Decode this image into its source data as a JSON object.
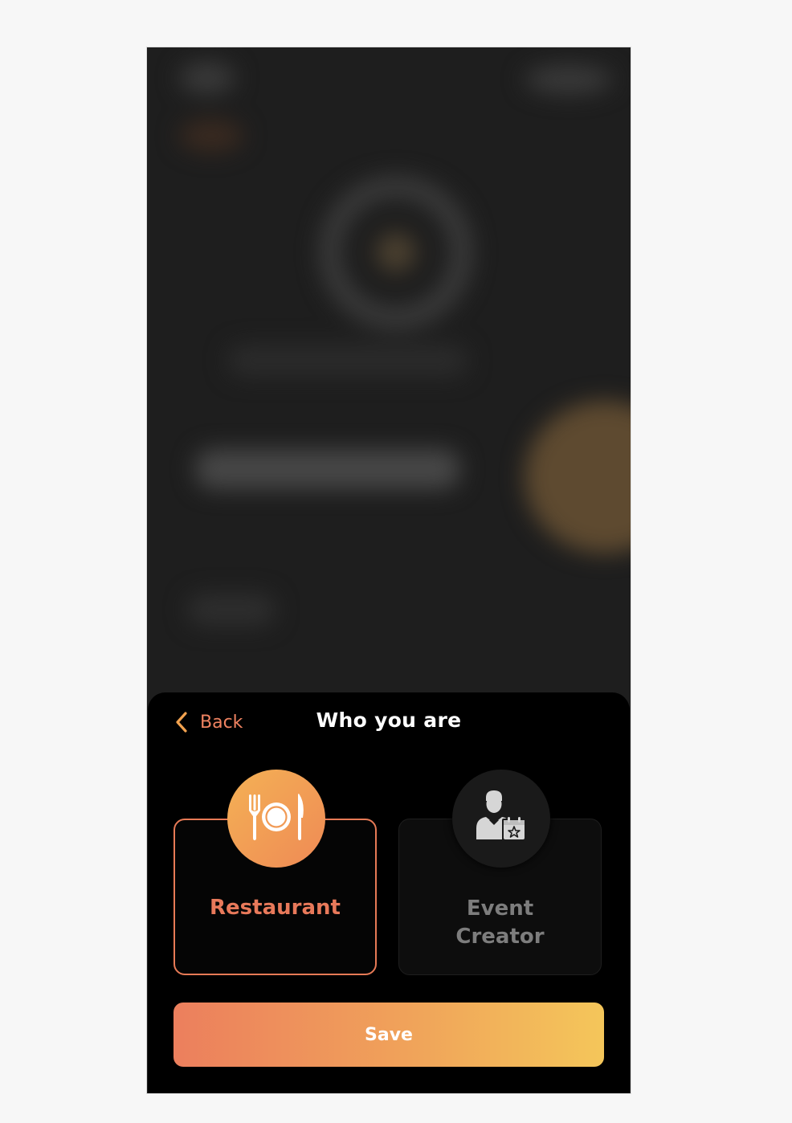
{
  "sheet": {
    "back_label": "Back",
    "title": "Who you are"
  },
  "options": [
    {
      "label": "Restaurant",
      "icon": "plate-cutlery-icon",
      "selected": true
    },
    {
      "label": "Event Creator",
      "icon": "event-creator-icon",
      "selected": false
    }
  ],
  "save_label": "Save",
  "colors": {
    "accent": "#e8795a",
    "gradient_start": "#ec7f5d",
    "gradient_end": "#f4c65a",
    "unselected_text": "#7d7d7d"
  }
}
